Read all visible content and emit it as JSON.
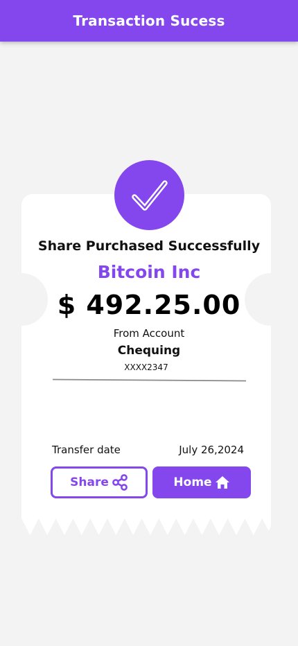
{
  "header": {
    "title": "Transaction Sucess"
  },
  "receipt": {
    "headline": "Share Purchased Successfully",
    "company": "Bitcoin Inc",
    "amount": "$ 492.25.00",
    "from_label": "From Account",
    "account_name": "Chequing",
    "account_number": "XXXX2347",
    "date_label": "Transfer date",
    "date_value": "July 26,2024"
  },
  "actions": {
    "share_label": "Share",
    "share_icon": "share-icon",
    "home_label": "Home",
    "home_icon": "home-icon"
  },
  "colors": {
    "accent": "#8447ee",
    "background": "#f3f3f3",
    "card": "#ffffff"
  }
}
